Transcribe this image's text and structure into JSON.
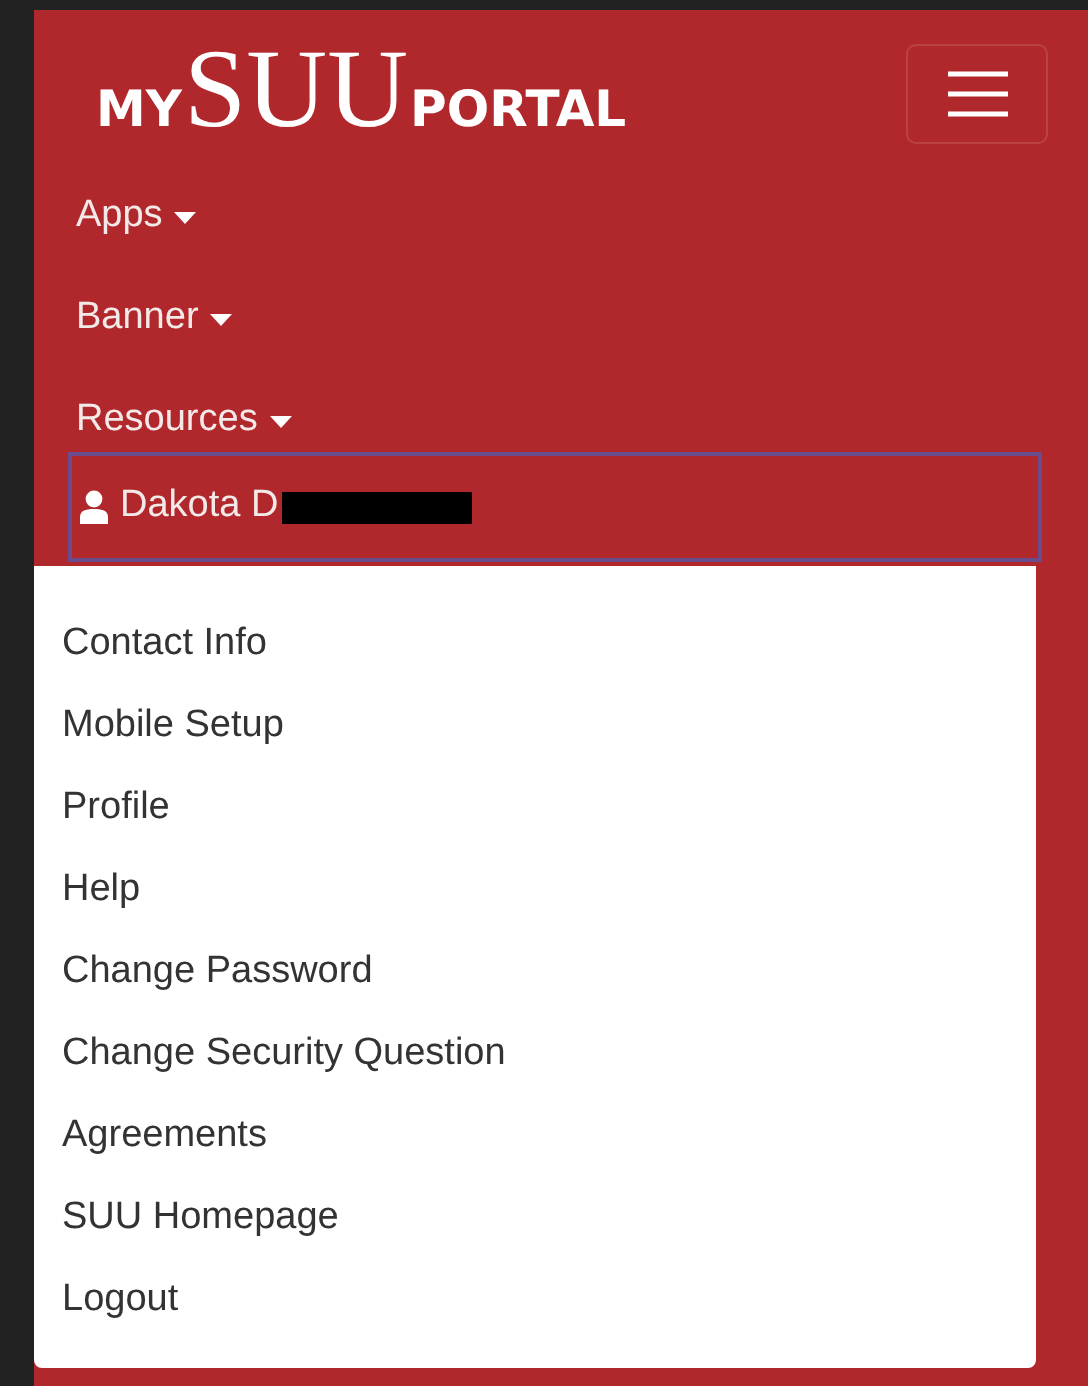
{
  "logo": {
    "prefix": "MY",
    "name": "SUU",
    "suffix": "PORTAL"
  },
  "nav_items": [
    {
      "label": "Apps",
      "kind": "dropdown",
      "focused": false
    },
    {
      "label": "Banner",
      "kind": "dropdown",
      "focused": false
    },
    {
      "label": "Resources",
      "kind": "dropdown",
      "focused": false
    },
    {
      "label": "Dakota D",
      "kind": "user",
      "focused": true,
      "redacted": true
    }
  ],
  "user_menu": [
    "Contact Info",
    "Mobile Setup",
    "Profile",
    "Help",
    "Change Password",
    "Change Security Question",
    "Agreements",
    "SUU Homepage",
    "Logout"
  ]
}
